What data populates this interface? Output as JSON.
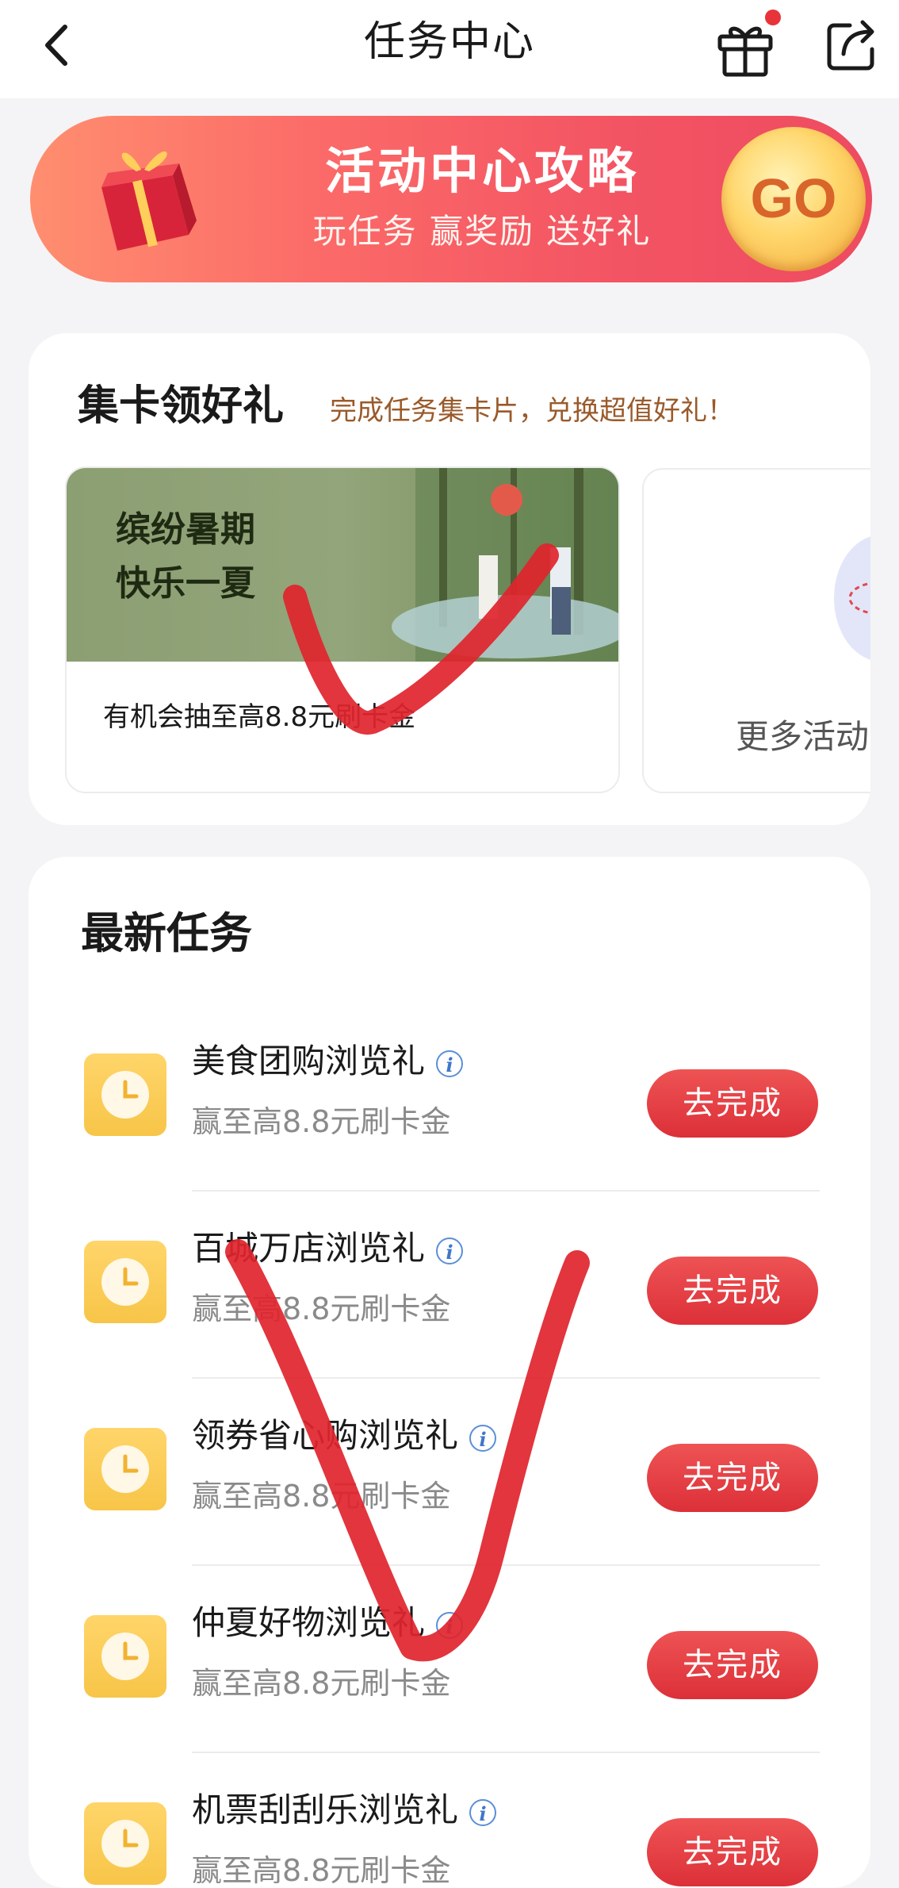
{
  "nav": {
    "title": "任务中心",
    "back_icon": "chevron-left-icon",
    "gift_icon": "gift-icon",
    "share_icon": "share-icon",
    "badge_color": "#e8333b"
  },
  "banner": {
    "title": "活动中心攻略",
    "subtitle": "玩任务 赢奖励 送好礼",
    "go_label": "GO",
    "colors": {
      "start": "#ff8e6f",
      "end": "#ee4b60",
      "go_text": "#d9652a"
    }
  },
  "collect": {
    "title": "集卡领好礼",
    "subtitle": "完成任务集卡片，兑换超值好礼！",
    "promo": {
      "line1": "缤纷暑期",
      "line2": "快乐一夏",
      "description": "有机会抽至高8.8元刷卡金"
    },
    "more_label": "更多活动"
  },
  "tasks": {
    "title": "最新任务",
    "button_color": "#e23c40",
    "items": [
      {
        "name": "美食团购浏览礼",
        "reward": "赢至高8.8元刷卡金",
        "button": "去完成",
        "icon": "clock-icon"
      },
      {
        "name": "百城万店浏览礼",
        "reward": "赢至高8.8元刷卡金",
        "button": "去完成",
        "icon": "clock-icon"
      },
      {
        "name": "领券省心购浏览礼",
        "reward": "赢至高8.8元刷卡金",
        "button": "去完成",
        "icon": "clock-icon"
      },
      {
        "name": "仲夏好物浏览礼",
        "reward": "赢至高8.8元刷卡金",
        "button": "去完成",
        "icon": "clock-icon"
      },
      {
        "name": "机票刮刮乐浏览礼",
        "reward": "赢至高8.8元刷卡金",
        "button": "去完成",
        "icon": "clock-icon"
      }
    ]
  }
}
